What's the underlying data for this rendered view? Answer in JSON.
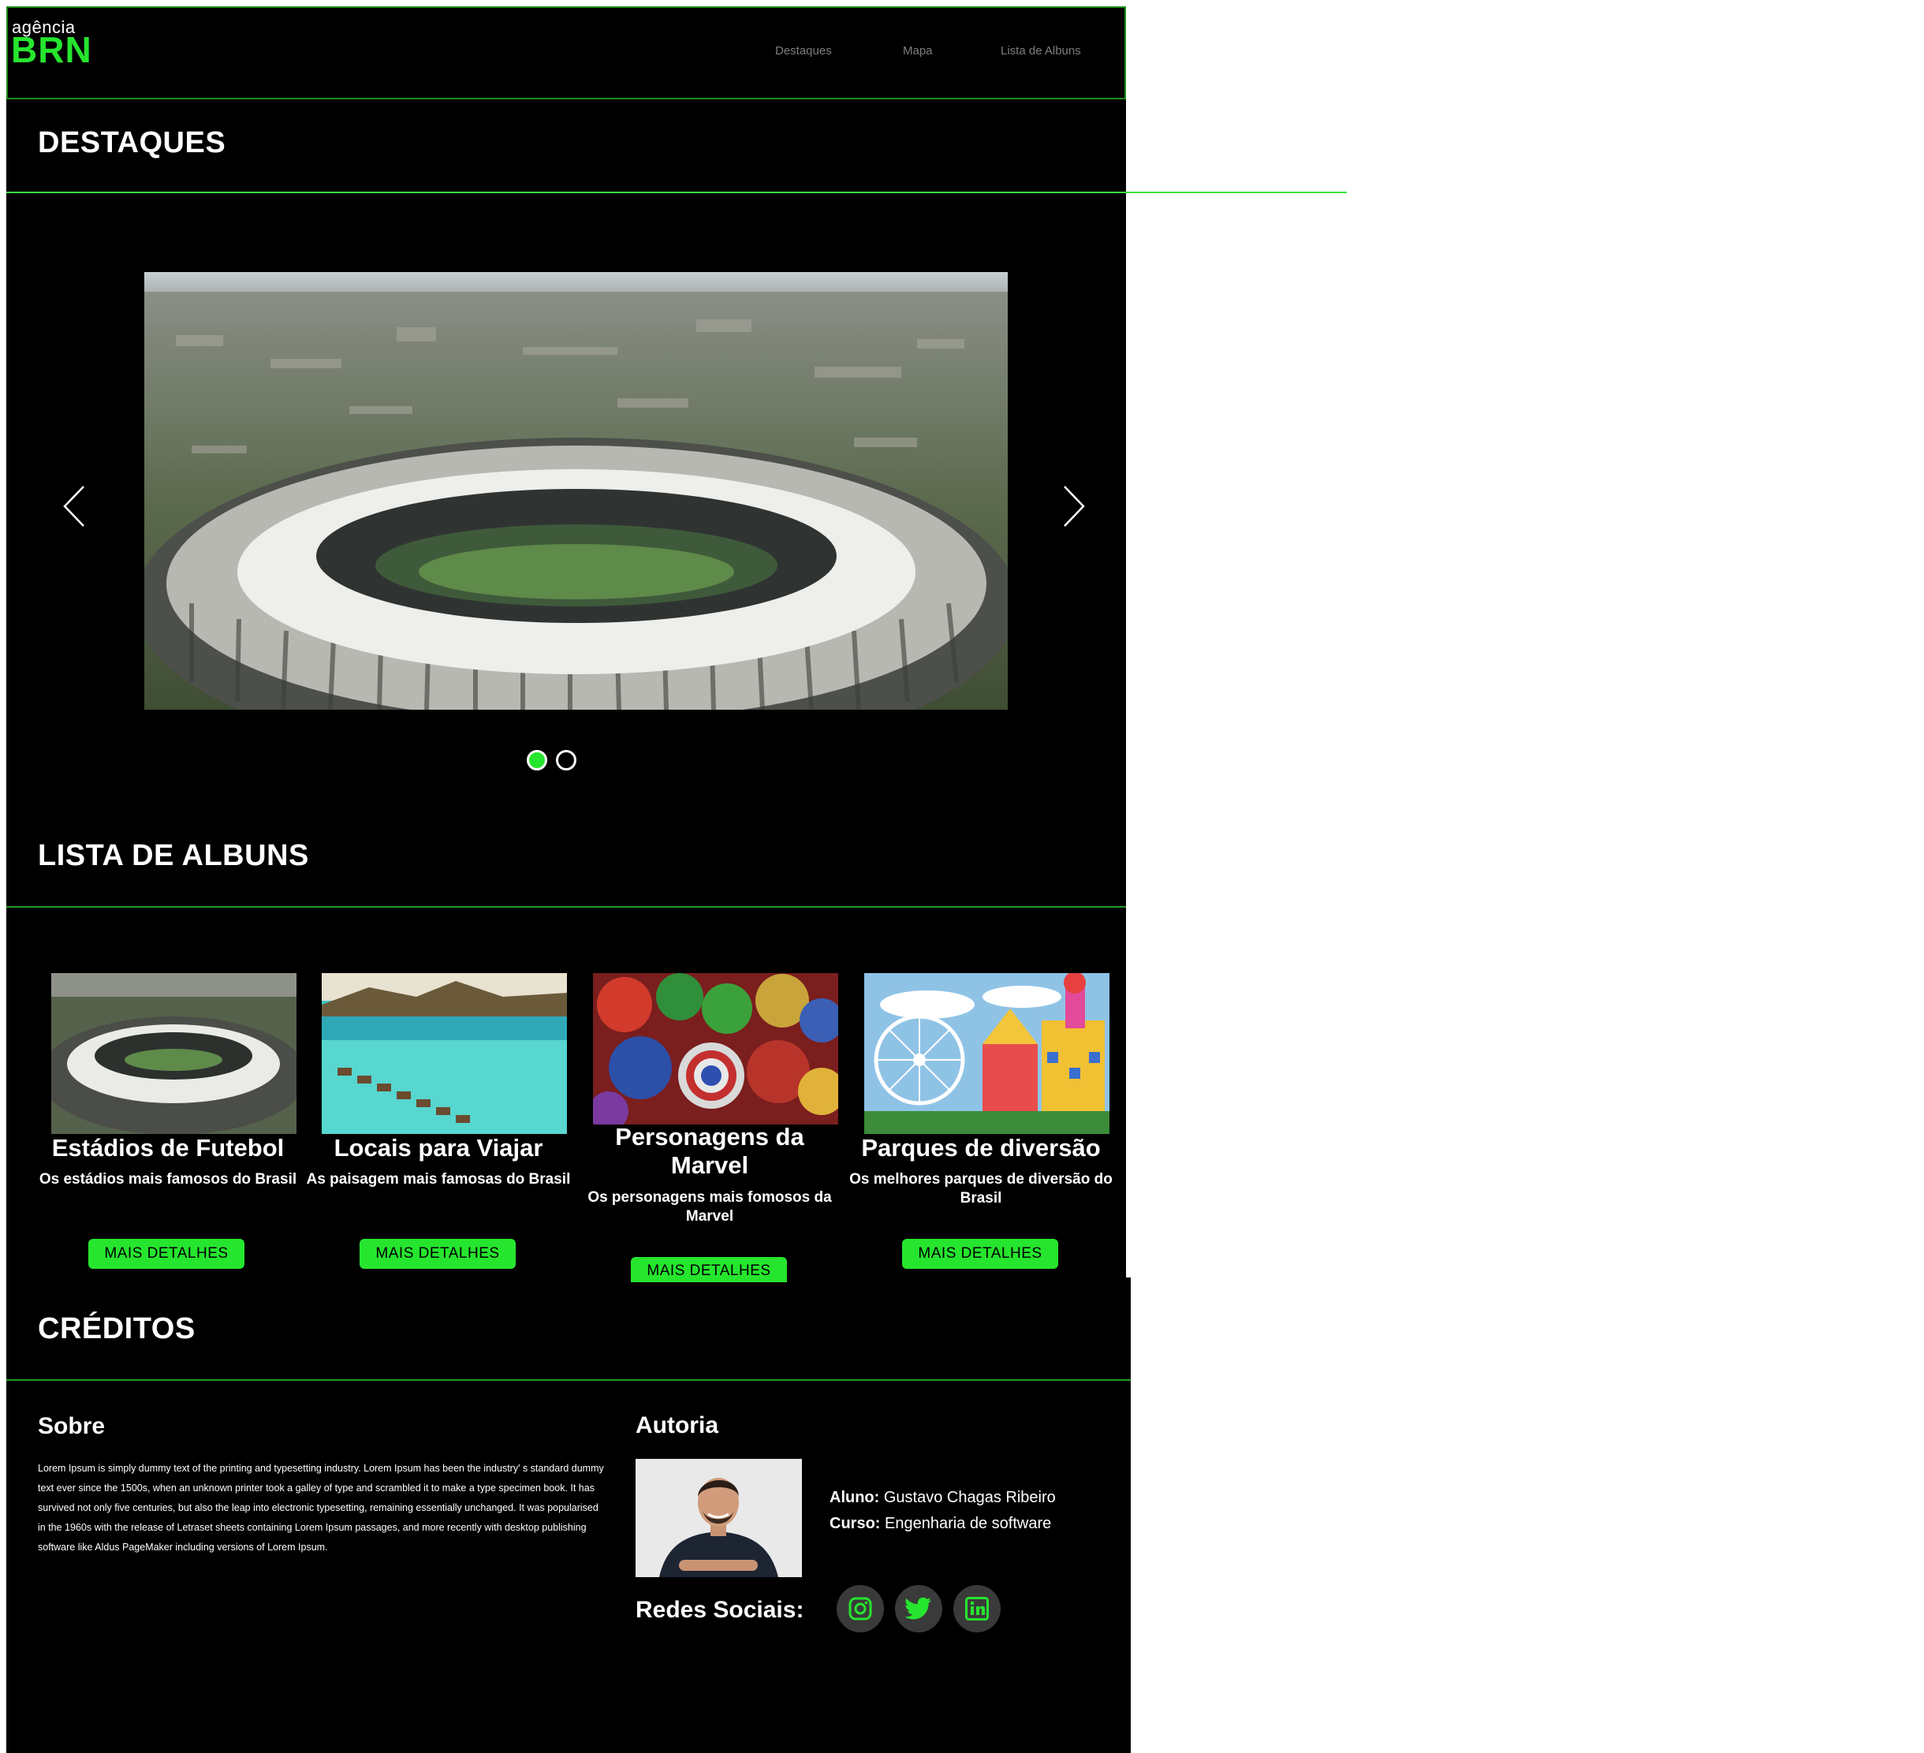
{
  "header": {
    "logo_small": "agência",
    "logo_big": "BRN",
    "nav": [
      "Destaques",
      "Mapa",
      "Lista de Albuns"
    ]
  },
  "sections": {
    "destaques": "DESTAQUES",
    "albuns": "LISTA DE ALBUNS",
    "creditos": "CRÉDITOS"
  },
  "carousel": {
    "active_index": 0,
    "slide_count": 2
  },
  "albums": [
    {
      "title": "Estádios de Futebol",
      "description": "Os estádios mais famosos do Brasil",
      "button": "MAIS DETALHES"
    },
    {
      "title": "Locais para Viajar",
      "description": "As paisagem mais famosas do Brasil",
      "button": "MAIS DETALHES"
    },
    {
      "title": "Personagens da Marvel",
      "description": "Os personagens mais fomosos da Marvel",
      "button": "MAIS DETALHES"
    },
    {
      "title": "Parques de diversão",
      "description": "Os melhores parques de diversão do Brasil",
      "button": "MAIS DETALHES"
    }
  ],
  "credits": {
    "about_title": "Sobre",
    "about_text": "Lorem Ipsum is simply dummy text of the printing and typesetting industry. Lorem Ipsum has been the industry' s standard dummy text ever since the 1500s, when an unknown printer took a galley of type and scrambled it to make a type specimen book. It has survived not only five centuries, but also the leap into electronic typesetting, remaining essentially unchanged. It was popularised in the 1960s with the release of Letraset sheets containing Lorem Ipsum passages, and more recently with desktop publishing software like Aldus PageMaker including versions of Lorem Ipsum.",
    "author_title": "Autoria",
    "student_label": "Aluno:",
    "student_name": "Gustavo Chagas Ribeiro",
    "course_label": "Curso:",
    "course_name": "Engenharia de software",
    "social_label": "Redes Sociais:",
    "social_icons": [
      "instagram-icon",
      "twitter-icon",
      "linkedin-icon"
    ]
  },
  "colors": {
    "accent": "#26e52e",
    "rule": "#1f9a1f",
    "background": "#000000",
    "nav_text": "#7d7d7d"
  }
}
